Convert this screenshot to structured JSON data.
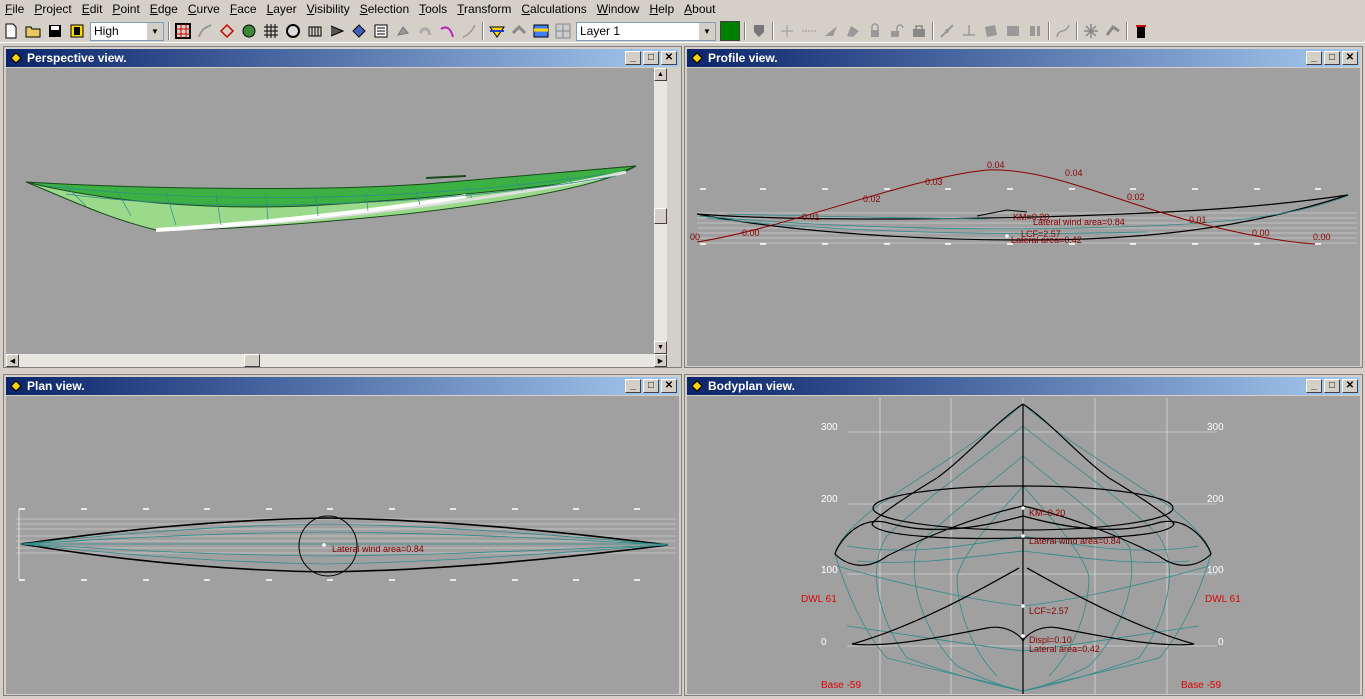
{
  "menu": {
    "items": [
      {
        "label": "File"
      },
      {
        "label": "Project"
      },
      {
        "label": "Edit"
      },
      {
        "label": "Point"
      },
      {
        "label": "Edge"
      },
      {
        "label": "Curve"
      },
      {
        "label": "Face"
      },
      {
        "label": "Layer"
      },
      {
        "label": "Visibility"
      },
      {
        "label": "Selection"
      },
      {
        "label": "Tools"
      },
      {
        "label": "Transform"
      },
      {
        "label": "Calculations"
      },
      {
        "label": "Window"
      },
      {
        "label": "Help"
      },
      {
        "label": "About"
      }
    ]
  },
  "toolbar": {
    "precision_value": "High",
    "layer_value": "Layer 1",
    "layer_color": "#008000"
  },
  "windows": {
    "perspective": {
      "title": "Perspective view."
    },
    "profile": {
      "title": "Profile view."
    },
    "plan": {
      "title": "Plan view."
    },
    "bodyplan": {
      "title": "Bodyplan view."
    }
  },
  "profile": {
    "curve_labels": [
      "0.00",
      "0.01",
      "0.02",
      "0.03",
      "0.04",
      "0.04",
      "0.02",
      "0.01",
      "0.00",
      "0.00"
    ],
    "left_edge_label": "00",
    "km": "KM=0.20",
    "lateral_wind": "Lateral wind area=0.84",
    "lcf": "LCF=2.57",
    "lateral_area": "Lateral area=0.42"
  },
  "plan": {
    "lateral_wind": "Lateral wind area=0.84"
  },
  "bodyplan": {
    "left_labels": [
      "300",
      "200",
      "100",
      "0"
    ],
    "right_labels": [
      "300",
      "200",
      "100",
      "0"
    ],
    "dwl_left": "DWL 61",
    "dwl_right": "DWL 61",
    "base_left": "Base -59",
    "base_right": "Base -59",
    "km": "KM=0.20",
    "lateral_wind": "Lateral wind area=0.84",
    "lcf": "LCF=2.57",
    "displ": "Displ=0.10",
    "lateral_area": "Lateral area=0.42",
    "hull_color": "#2e8b8b",
    "label_color": "#8b0000"
  },
  "perspective": {
    "hull_color": "#3cb043"
  }
}
